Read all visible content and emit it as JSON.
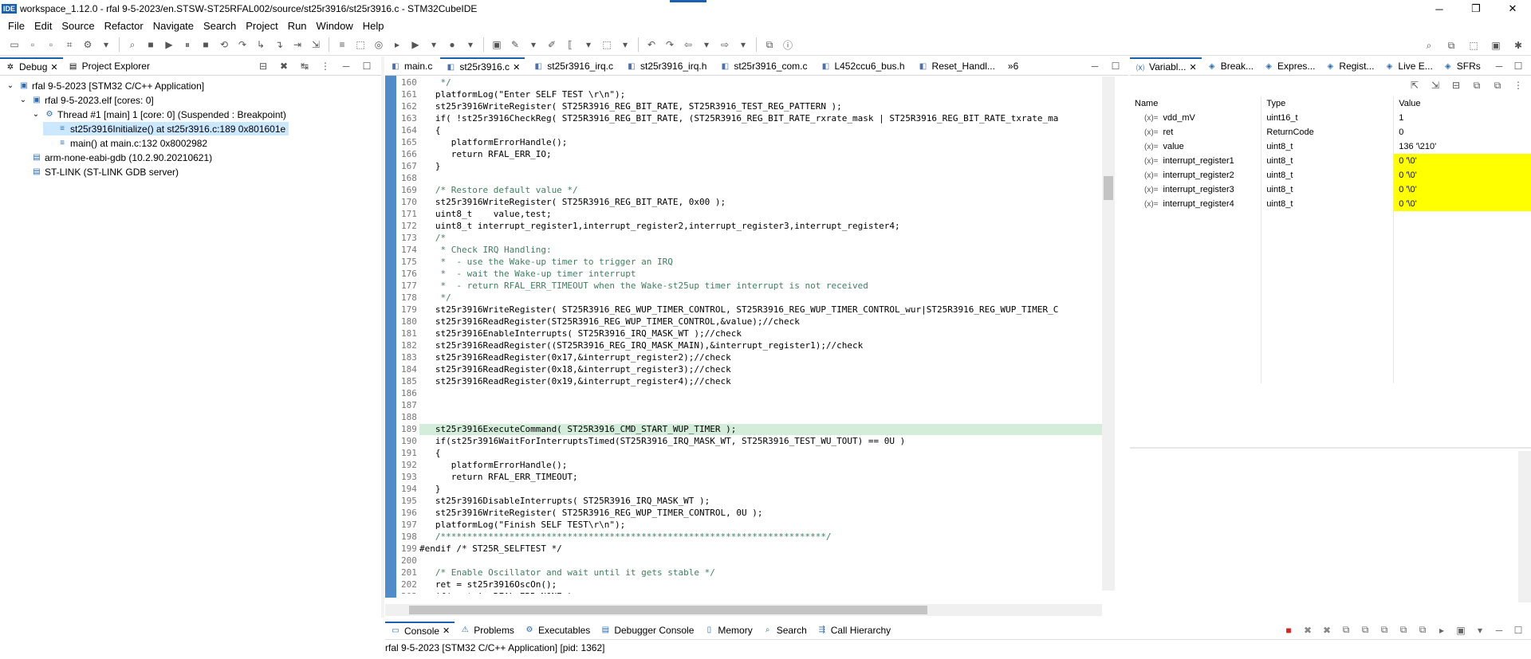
{
  "window": {
    "ide_badge": "IDE",
    "title": "workspace_1.12.0 - rfal 9-5-2023/en.STSW-ST25RFAL002/source/st25r3916/st25r3916.c - STM32CubeIDE",
    "minimize": "─",
    "maximize": "❐",
    "close": "✕"
  },
  "menu": [
    "File",
    "Edit",
    "Source",
    "Refactor",
    "Navigate",
    "Search",
    "Project",
    "Run",
    "Window",
    "Help"
  ],
  "left_panel": {
    "tabs": [
      {
        "label": "Debug",
        "icon": "bug-icon"
      },
      {
        "label": "Project Explorer",
        "icon": "folder-icon"
      }
    ],
    "tree": [
      {
        "label": "rfal 9-5-2023 [STM32 C/C++ Application]",
        "indent": 0,
        "expander": "⌄",
        "icon": "IDE"
      },
      {
        "label": "rfal 9-5-2023.elf [cores: 0]",
        "indent": 1,
        "expander": "⌄",
        "icon": "▣"
      },
      {
        "label": "Thread #1 [main] 1 [core: 0] (Suspended : Breakpoint)",
        "indent": 2,
        "expander": "⌄",
        "icon": "⚙"
      },
      {
        "label": "st25r3916Initialize() at st25r3916.c:189 0x801601e",
        "indent": 3,
        "expander": "",
        "icon": "≡",
        "selected": true
      },
      {
        "label": "main() at main.c:132 0x8002982",
        "indent": 3,
        "expander": "",
        "icon": "≡"
      },
      {
        "label": "arm-none-eabi-gdb (10.2.90.20210621)",
        "indent": 1,
        "expander": "",
        "icon": "▤"
      },
      {
        "label": "ST-LINK (ST-LINK GDB server)",
        "indent": 1,
        "expander": "",
        "icon": "▤"
      }
    ]
  },
  "editor": {
    "tabs": [
      "main.c",
      "st25r3916.c",
      "st25r3916_irq.c",
      "st25r3916_irq.h",
      "st25r3916_com.c",
      "L452ccu6_bus.h",
      "Reset_Handl..."
    ],
    "active_tab": "st25r3916.c",
    "overflow": "»6",
    "lines": [
      {
        "n": "160",
        "t": "    */",
        "c": true
      },
      {
        "n": "161",
        "t": "   platformLog(\"Enter SELF TEST \\r\\n\");"
      },
      {
        "n": "162",
        "t": "   st25r3916WriteRegister( ST25R3916_REG_BIT_RATE, ST25R3916_TEST_REG_PATTERN );"
      },
      {
        "n": "163",
        "t": "   if( !st25r3916CheckReg( ST25R3916_REG_BIT_RATE, (ST25R3916_REG_BIT_RATE_rxrate_mask | ST25R3916_REG_BIT_RATE_txrate_ma"
      },
      {
        "n": "164",
        "t": "   {"
      },
      {
        "n": "165",
        "t": "      platformErrorHandle();"
      },
      {
        "n": "166",
        "t": "      return RFAL_ERR_IO;"
      },
      {
        "n": "167",
        "t": "   }"
      },
      {
        "n": "168",
        "t": ""
      },
      {
        "n": "169",
        "t": "   /* Restore default value */",
        "c": true
      },
      {
        "n": "170",
        "t": "   st25r3916WriteRegister( ST25R3916_REG_BIT_RATE, 0x00 );"
      },
      {
        "n": "171",
        "t": "   uint8_t    value,test;"
      },
      {
        "n": "172",
        "t": "   uint8_t interrupt_register1,interrupt_register2,interrupt_register3,interrupt_register4;"
      },
      {
        "n": "173",
        "t": "   /*",
        "c": true
      },
      {
        "n": "174",
        "t": "    * Check IRQ Handling:",
        "c": true
      },
      {
        "n": "175",
        "t": "    *  - use the Wake-up timer to trigger an IRQ",
        "c": true
      },
      {
        "n": "176",
        "t": "    *  - wait the Wake-up timer interrupt",
        "c": true
      },
      {
        "n": "177",
        "t": "    *  - return RFAL_ERR_TIMEOUT when the Wake-st25up timer interrupt is not received",
        "c": true
      },
      {
        "n": "178",
        "t": "    */",
        "c": true
      },
      {
        "n": "179",
        "t": "   st25r3916WriteRegister( ST25R3916_REG_WUP_TIMER_CONTROL, ST25R3916_REG_WUP_TIMER_CONTROL_wur|ST25R3916_REG_WUP_TIMER_C"
      },
      {
        "n": "180",
        "t": "   st25r3916ReadRegister(ST25R3916_REG_WUP_TIMER_CONTROL,&value);//check"
      },
      {
        "n": "181",
        "t": "   st25r3916EnableInterrupts( ST25R3916_IRQ_MASK_WT );//check"
      },
      {
        "n": "182",
        "t": "   st25r3916ReadRegister((ST25R3916_REG_IRQ_MASK_MAIN),&interrupt_register1);//check"
      },
      {
        "n": "183",
        "t": "   st25r3916ReadRegister(0x17,&interrupt_register2);//check"
      },
      {
        "n": "184",
        "t": "   st25r3916ReadRegister(0x18,&interrupt_register3);//check"
      },
      {
        "n": "185",
        "t": "   st25r3916ReadRegister(0x19,&interrupt_register4);//check"
      },
      {
        "n": "186",
        "t": ""
      },
      {
        "n": "187",
        "t": ""
      },
      {
        "n": "188",
        "t": ""
      },
      {
        "n": "189",
        "t": "   st25r3916ExecuteCommand( ST25R3916_CMD_START_WUP_TIMER );",
        "hl": true
      },
      {
        "n": "190",
        "t": "   if(st25r3916WaitForInterruptsTimed(ST25R3916_IRQ_MASK_WT, ST25R3916_TEST_WU_TOUT) == 0U )"
      },
      {
        "n": "191",
        "t": "   {"
      },
      {
        "n": "192",
        "t": "      platformErrorHandle();"
      },
      {
        "n": "193",
        "t": "      return RFAL_ERR_TIMEOUT;"
      },
      {
        "n": "194",
        "t": "   }"
      },
      {
        "n": "195",
        "t": "   st25r3916DisableInterrupts( ST25R3916_IRQ_MASK_WT );"
      },
      {
        "n": "196",
        "t": "   st25r3916WriteRegister( ST25R3916_REG_WUP_TIMER_CONTROL, 0U );"
      },
      {
        "n": "197",
        "t": "   platformLog(\"Finish SELF TEST\\r\\n\");"
      },
      {
        "n": "198",
        "t": "   /*************************************************************************/",
        "c": true
      },
      {
        "n": "199",
        "t": "#endif /* ST25R_SELFTEST */"
      },
      {
        "n": "200",
        "t": ""
      },
      {
        "n": "201",
        "t": "   /* Enable Oscillator and wait until it gets stable */",
        "c": true
      },
      {
        "n": "202",
        "t": "   ret = st25r3916OscOn();"
      },
      {
        "n": "203",
        "t": "   if( ret != RFAL_ERR_NONE )"
      }
    ]
  },
  "right_panel": {
    "tabs": [
      "Variabl...",
      "Break...",
      "Expres...",
      "Regist...",
      "Live E...",
      "SFRs"
    ],
    "columns": [
      "Name",
      "Type",
      "Value"
    ],
    "rows": [
      {
        "name": "vdd_mV",
        "type": "uint16_t",
        "value": "1",
        "changed": false
      },
      {
        "name": "ret",
        "type": "ReturnCode",
        "value": "0",
        "changed": false
      },
      {
        "name": "value",
        "type": "uint8_t",
        "value": "136 '\\210'",
        "changed": false
      },
      {
        "name": "interrupt_register1",
        "type": "uint8_t",
        "value": "0 '\\0'",
        "changed": true
      },
      {
        "name": "interrupt_register2",
        "type": "uint8_t",
        "value": "0 '\\0'",
        "changed": true
      },
      {
        "name": "interrupt_register3",
        "type": "uint8_t",
        "value": "0 '\\0'",
        "changed": true
      },
      {
        "name": "interrupt_register4",
        "type": "uint8_t",
        "value": "0 '\\0'",
        "changed": true
      }
    ]
  },
  "bottom_panel": {
    "tabs": [
      "Console",
      "Problems",
      "Executables",
      "Debugger Console",
      "Memory",
      "Search",
      "Call Hierarchy"
    ],
    "status": "rfal 9-5-2023 [STM32 C/C++ Application]  [pid: 1362]"
  }
}
